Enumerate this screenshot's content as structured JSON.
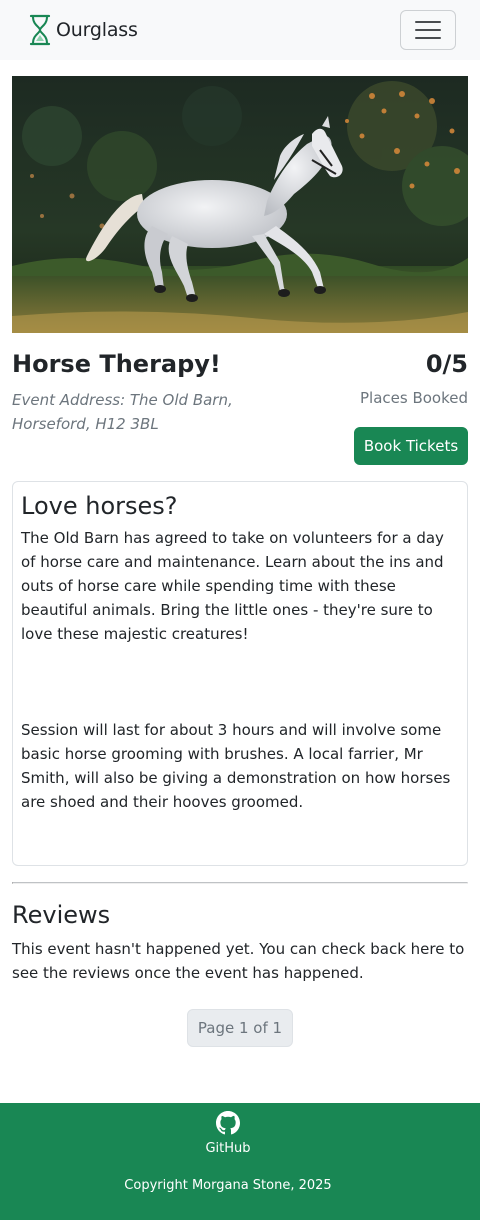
{
  "navbar": {
    "brand": "Ourglass",
    "brand_icon": "hourglass-icon",
    "toggle_icon": "hamburger-menu-icon"
  },
  "event": {
    "title": "Horse Therapy!",
    "places_booked_value": "0/5",
    "places_booked_label": "Places Booked",
    "address": "Event Address: The Old Barn, Horseford, H12 3BL",
    "book_button": "Book Tickets",
    "hero_alt": "White horse galloping"
  },
  "description": {
    "heading": "Love horses?",
    "paragraph_1": "The Old Barn has agreed to take on volunteers for a day of horse care and maintenance. Learn about the ins and outs of horse care while spending time with these beautiful animals. Bring the little ones - they're sure to love these majestic creatures!",
    "paragraph_2": "Session will last for about 3 hours and will involve some basic horse grooming with brushes. A local farrier, Mr Smith, will also be giving a demonstration on how horses are shoed and their hooves groomed."
  },
  "reviews": {
    "heading": "Reviews",
    "empty_text": "This event hasn't happened yet. You can check back here to see the reviews once the event has happened.",
    "pagination": "Page 1 of 1"
  },
  "footer": {
    "github_label": "GitHub",
    "github_icon": "github-icon",
    "copyright": "Copyright Morgana Stone, 2025"
  },
  "colors": {
    "primary_green": "#198754",
    "navbar_bg": "#f8f9fa",
    "muted_text": "#6c757d"
  }
}
